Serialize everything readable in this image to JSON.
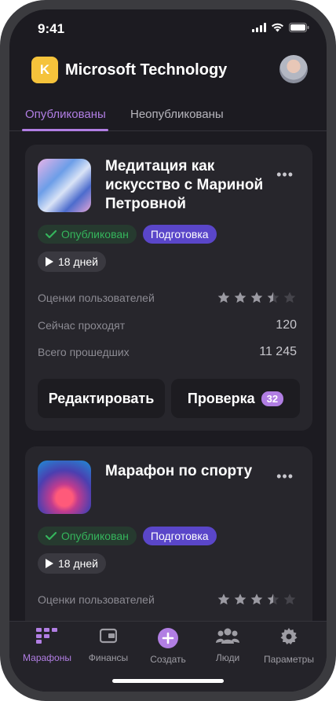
{
  "status": {
    "time": "9:41"
  },
  "header": {
    "logo_letter": "K",
    "title": "Microsoft Technology"
  },
  "tabs": [
    {
      "label": "Опубликованы"
    },
    {
      "label": "Неопубликованы"
    }
  ],
  "cards": [
    {
      "title": "Медитация как искусство с Мариной Петровной",
      "badges": {
        "published": "Опубликован",
        "preparing": "Подготовка"
      },
      "duration": "18 дней",
      "rows": [
        {
          "label": "Оценки пользователей",
          "rating": 3.5
        },
        {
          "label": "Сейчас проходят",
          "value": "120"
        },
        {
          "label": "Всего прошедших",
          "value": "11 245"
        }
      ],
      "actions": {
        "edit": "Редактировать",
        "check": "Проверка",
        "check_count": "32"
      }
    },
    {
      "title": "Марафон по спорту",
      "badges": {
        "published": "Опубликован",
        "preparing": "Подготовка"
      },
      "duration": "18 дней",
      "rows": [
        {
          "label": "Оценки пользователей",
          "rating": 3.5
        }
      ]
    }
  ],
  "bottom_nav": [
    {
      "label": "Марафоны",
      "icon": "grid-icon"
    },
    {
      "label": "Финансы",
      "icon": "wallet-icon"
    },
    {
      "label": "Создать",
      "icon": "plus-circle-icon"
    },
    {
      "label": "Люди",
      "icon": "people-icon"
    },
    {
      "label": "Параметры",
      "icon": "gear-icon"
    }
  ],
  "colors": {
    "accent": "#b17ee3",
    "badge_green": "#35b55c",
    "badge_purple": "#5a46c9",
    "logo": "#f5c33b"
  }
}
